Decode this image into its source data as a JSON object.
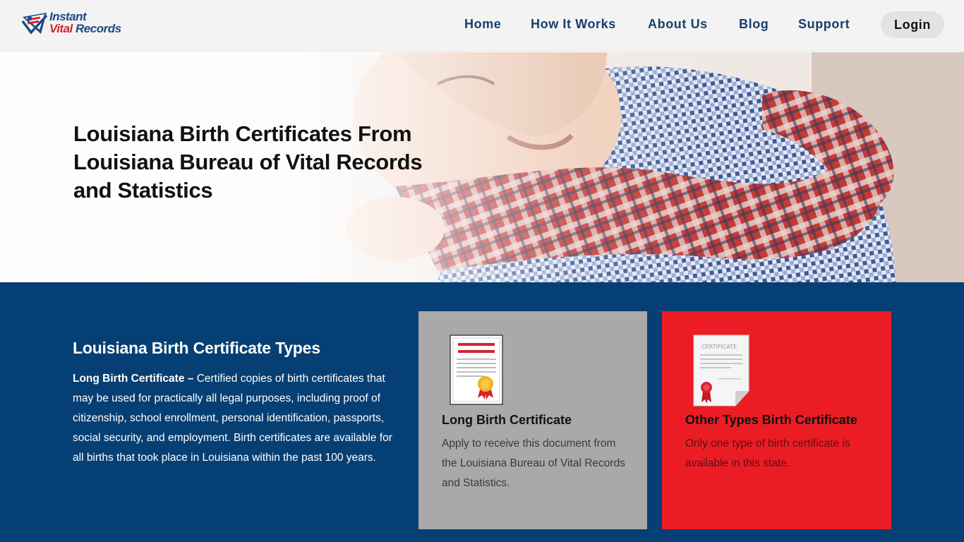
{
  "brand": {
    "line1": "Instant",
    "line2_a": "Vital",
    "line2_b": " Records"
  },
  "nav": {
    "items": [
      "Home",
      "How It Works",
      "About Us",
      "Blog",
      "Support"
    ],
    "login": "Login"
  },
  "hero": {
    "title": "Louisiana Birth Certificates From Louisiana Bureau of Vital Records and Statistics"
  },
  "types": {
    "heading": "Louisiana Birth Certificate Types",
    "lead_bold": "Long Birth Certificate –",
    "lead_text": " Certified copies of birth certificates that may be used for practically all legal purposes, including proof of citizenship, school enrollment, personal identification, passports, social security, and employment. Birth certificates are available for all births that took place in Louisiana within the past 100 years."
  },
  "cards": [
    {
      "title": "Long Birth Certificate",
      "desc": "Apply to receive this document from the Louisiana Bureau of Vital Records and Statistics.",
      "icon": "certificate-ribbon-icon"
    },
    {
      "title": "Other Types Birth Certificate",
      "desc": "Only one type of birth certificate is available in this state.",
      "icon": "certificate-seal-icon",
      "icon_label": "CERTIFICATE"
    }
  ],
  "colors": {
    "navy": "#063f73",
    "nav_text": "#163e6e",
    "card_gray": "#a9a9a9",
    "card_red": "#ec1c24",
    "brand_red": "#d62330"
  }
}
